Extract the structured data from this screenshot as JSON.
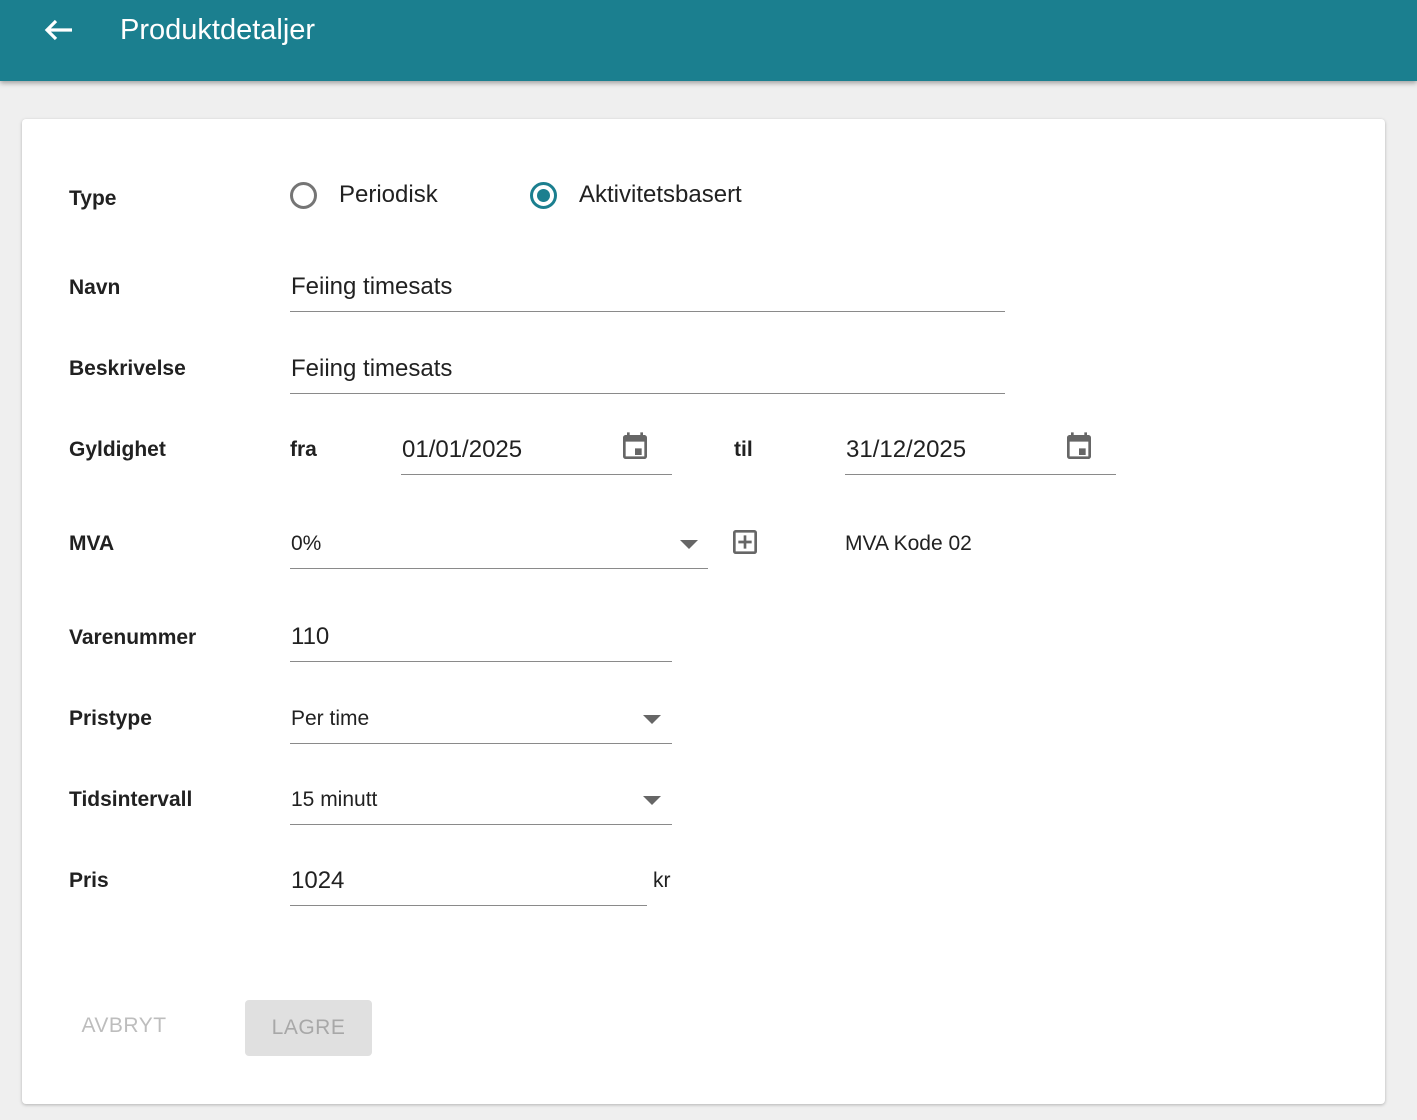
{
  "header": {
    "title": "Produktdetaljer",
    "background": "#1b7f8f"
  },
  "form": {
    "type": {
      "label": "Type",
      "options": [
        {
          "label": "Periodisk",
          "checked": false
        },
        {
          "label": "Aktivitetsbasert",
          "checked": true
        }
      ]
    },
    "name": {
      "label": "Navn",
      "value": "Feiing timesats"
    },
    "description": {
      "label": "Beskrivelse",
      "value": "Feiing timesats"
    },
    "validity": {
      "label": "Gyldighet",
      "from_label": "fra",
      "from_value": "01/01/2025",
      "to_label": "til",
      "to_value": "31/12/2025"
    },
    "vat": {
      "label": "MVA",
      "value": "0%",
      "code_text": "MVA Kode 02"
    },
    "item_number": {
      "label": "Varenummer",
      "value": "110"
    },
    "price_type": {
      "label": "Pristype",
      "value": "Per time"
    },
    "time_interval": {
      "label": "Tidsintervall",
      "value": "15 minutt"
    },
    "price": {
      "label": "Pris",
      "value": "1024",
      "unit": "kr"
    }
  },
  "actions": {
    "cancel_label": "AVBRYT",
    "save_label": "LAGRE"
  },
  "icons": {
    "back": "arrow-left-icon",
    "calendar": "calendar-icon",
    "dropdown": "chevron-down-icon",
    "add": "add-box-icon"
  },
  "colors": {
    "accent": "#1b7f8f",
    "page_background": "#efefef"
  }
}
